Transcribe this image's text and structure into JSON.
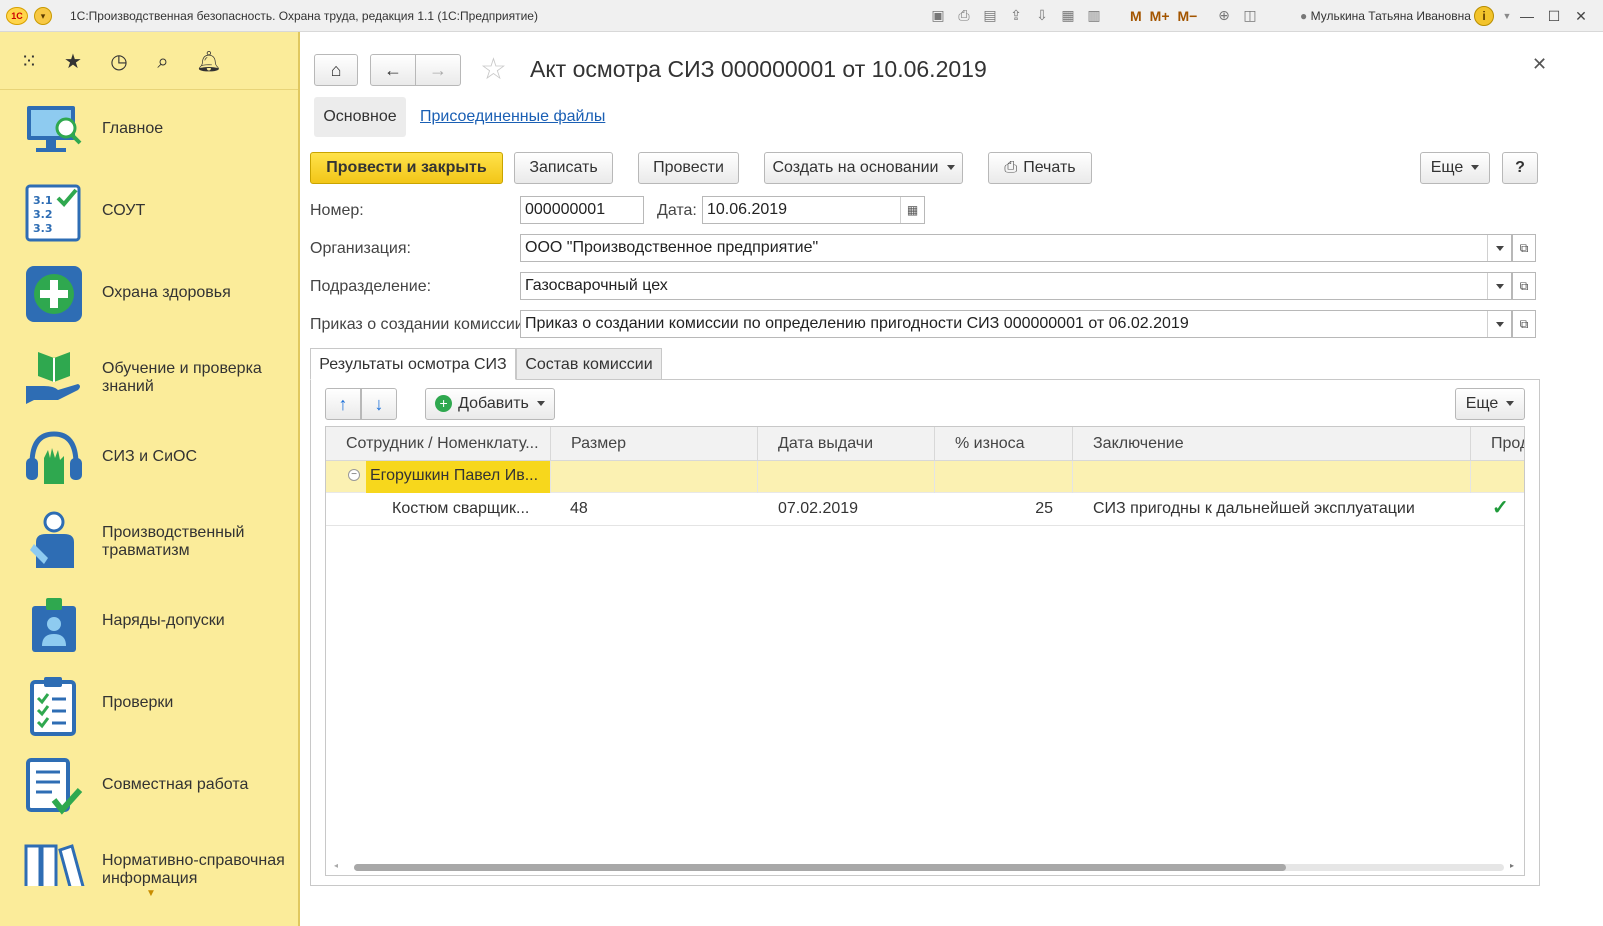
{
  "app": {
    "window_title": "1С:Производственная безопасность. Охрана труда, редакция 1.1  (1С:Предприятие)",
    "user": "Мулькина Татьяна Ивановна",
    "toolbar_m": [
      "M",
      "M+",
      "M−"
    ]
  },
  "sidebar": {
    "sections": [
      {
        "label": "Главное",
        "icon": "monitor-search-icon"
      },
      {
        "label": "СОУТ",
        "icon": "checklist-numbers-icon"
      },
      {
        "label": "Охрана здоровья",
        "icon": "medical-cross-icon"
      },
      {
        "label": "Обучение и проверка знаний",
        "icon": "book-hand-icon"
      },
      {
        "label": "СИЗ и СиОС",
        "icon": "helmet-gloves-icon"
      },
      {
        "label": "Производственный травматизм",
        "icon": "injured-person-icon"
      },
      {
        "label": "Наряды-допуски",
        "icon": "badge-person-icon"
      },
      {
        "label": "Проверки",
        "icon": "clipboard-check-icon"
      },
      {
        "label": "Совместная работа",
        "icon": "document-check-icon"
      },
      {
        "label": "Нормативно-справочная информация",
        "icon": "binders-icon"
      }
    ]
  },
  "form": {
    "title": "Акт осмотра СИЗ 000000001 от 10.06.2019",
    "nav_tabs": {
      "main": "Основное",
      "files": "Присоединенные файлы"
    },
    "buttons": {
      "post_close": "Провести и закрыть",
      "save": "Записать",
      "post": "Провести",
      "create_based": "Создать на основании",
      "print": "Печать",
      "more": "Еще",
      "help": "?"
    },
    "number_label": "Номер:",
    "number_value": "000000001",
    "date_label": "Дата:",
    "date_value": "10.06.2019",
    "org_label": "Организация:",
    "org_value": "ООО \"Производственное предприятие\"",
    "dept_label": "Подразделение:",
    "dept_value": "Газосварочный цех",
    "order_label": "Приказ о создании комиссии:",
    "order_value": "Приказ о создании комиссии по определению пригодности СИЗ 000000001 от 06.02.2019"
  },
  "tabs": [
    "Результаты осмотра СИЗ",
    "Состав комиссии"
  ],
  "table_toolbar": {
    "add": "Добавить",
    "more": "Еще"
  },
  "table": {
    "columns": [
      "Сотрудник / Номенклату...",
      "Размер",
      "Дата выдачи",
      "% износа",
      "Заключение",
      "Прод"
    ],
    "group_row": {
      "employee": "Егорушкин Павел Ив..."
    },
    "rows": [
      {
        "item": "Костюм сварщик...",
        "size": "48",
        "issue_date": "07.02.2019",
        "wear": "25",
        "conclusion": "СИЗ пригодны к дальнейшей эксплуатации",
        "extend": true
      }
    ]
  }
}
